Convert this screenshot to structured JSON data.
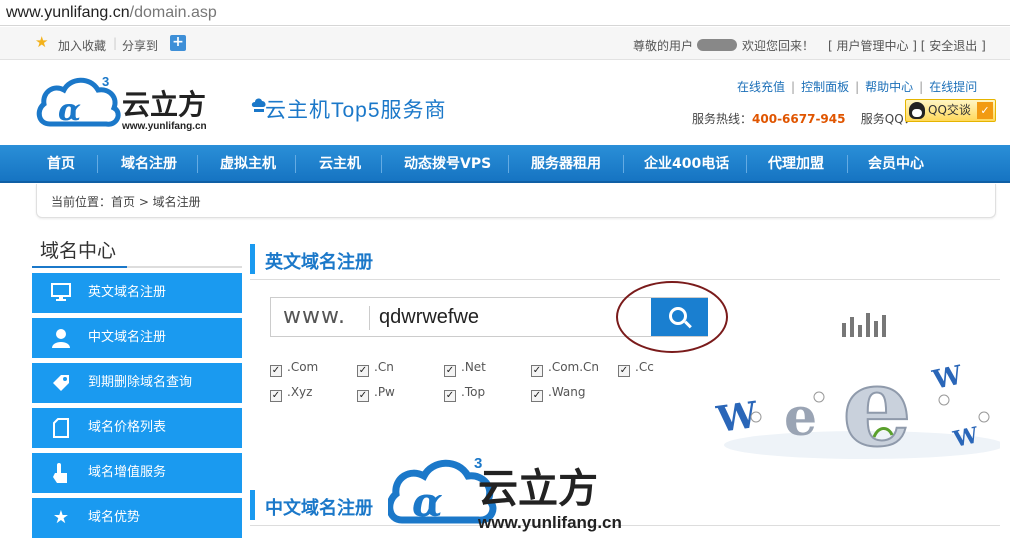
{
  "browser": {
    "url_host": "www.yunlifang.cn",
    "url_path": "/domain.asp"
  },
  "topbar": {
    "favorite": "加入收藏",
    "separator": "|",
    "share": "分享到",
    "greeting": "尊敬的用户",
    "welcome": "欢迎您回来！",
    "links": "[ 用户管理中心 ] [ 安全退出 ]"
  },
  "header": {
    "logo_text": "云立方",
    "logo_url": "www.yunlifang.cn",
    "slogan": "云主机Top5服务商",
    "links": [
      "在线充值",
      "控制面板",
      "帮助中心",
      "在线提问"
    ],
    "hotline_label": "服务热线：",
    "hotline": "400-6677-945",
    "qq_label": "服务QQ：",
    "qq_button": "QQ交谈"
  },
  "nav": [
    "首页",
    "域名注册",
    "虚拟主机",
    "云主机",
    "动态拨号VPS",
    "服务器租用",
    "企业400电话",
    "代理加盟",
    "会员中心"
  ],
  "breadcrumb": "当前位置：首页 > 域名注册",
  "sidebar": {
    "title": "域名中心",
    "items": [
      {
        "label": "英文域名注册",
        "icon": "monitor-icon"
      },
      {
        "label": "中文域名注册",
        "icon": "user-icon"
      },
      {
        "label": "到期删除域名查询",
        "icon": "tag-icon"
      },
      {
        "label": "域名价格列表",
        "icon": "document-icon"
      },
      {
        "label": "域名增值服务",
        "icon": "pointer-icon"
      },
      {
        "label": "域名优势",
        "icon": "star-icon"
      }
    ]
  },
  "main": {
    "section1_title": "英文域名注册",
    "search_prefix": "www.",
    "search_value": "qdwrwefwe",
    "tlds": [
      ".Com",
      ".Cn",
      ".Net",
      ".Com.Cn",
      ".Cc",
      ".Xyz",
      ".Pw",
      ".Top",
      ".Wang"
    ],
    "section2_title": "中文域名注册"
  },
  "watermark": {
    "text": "云立方",
    "url": "www.yunlifang.cn"
  },
  "colors": {
    "brand_blue": "#1a9af0",
    "nav_blue": "#1674c2",
    "hotline_orange": "#e05500",
    "annotation_circle": "#7a1b1b"
  }
}
